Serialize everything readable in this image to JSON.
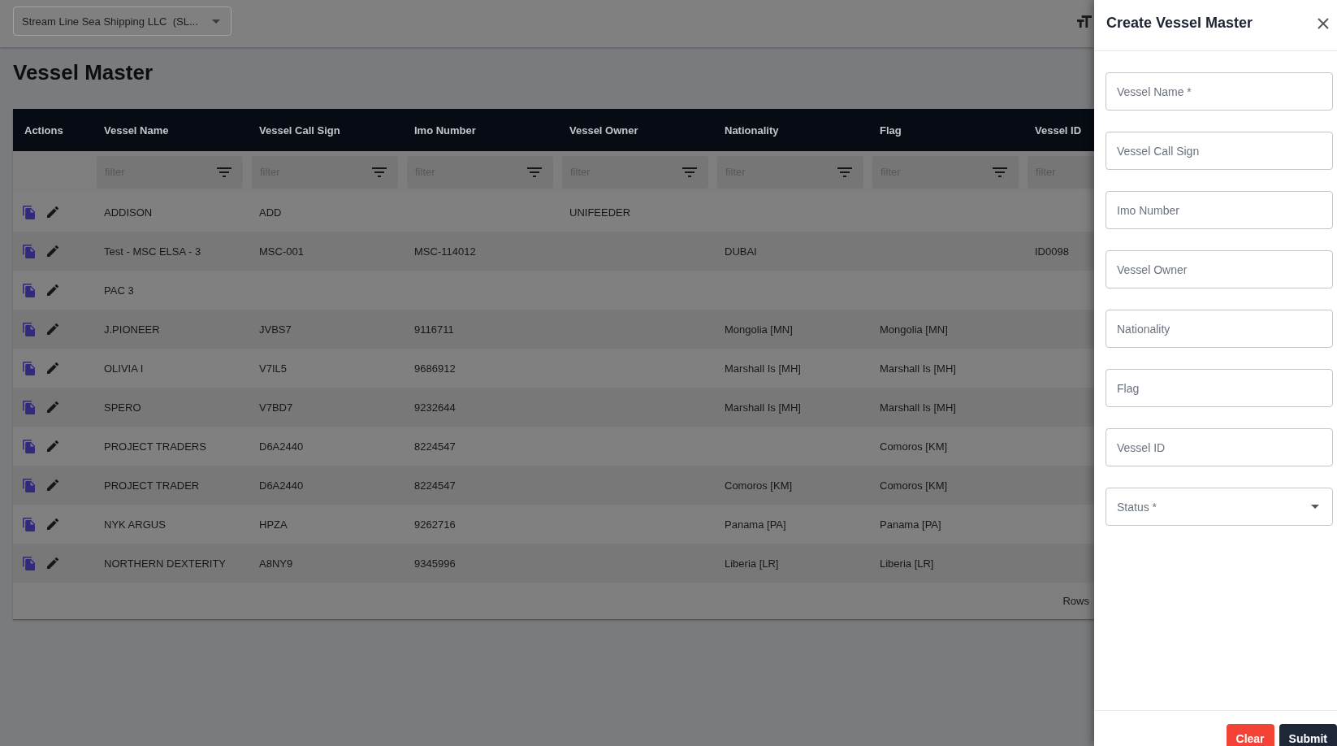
{
  "company_selector": {
    "value": "Stream Line Sea Shipping LLC  (SL..."
  },
  "page_title": "Vessel Master",
  "table": {
    "actions_header": "Actions",
    "columns": [
      {
        "label": "Vessel Name",
        "filter_placeholder": "filter"
      },
      {
        "label": "Vessel Call Sign",
        "filter_placeholder": "filter"
      },
      {
        "label": "Imo Number",
        "filter_placeholder": "filter"
      },
      {
        "label": "Vessel Owner",
        "filter_placeholder": "filter"
      },
      {
        "label": "Nationality",
        "filter_placeholder": "filter"
      },
      {
        "label": "Flag",
        "filter_placeholder": "filter"
      },
      {
        "label": "Vessel ID",
        "filter_placeholder": "filter"
      }
    ],
    "rows": [
      {
        "cells": [
          "ADDISON",
          "ADD",
          null,
          "UNIFEEDER",
          null,
          null,
          null
        ]
      },
      {
        "cells": [
          "Test - MSC ELSA - 3",
          "MSC-001",
          "MSC-114012",
          null,
          "DUBAI",
          null,
          "ID0098"
        ]
      },
      {
        "cells": [
          "PAC 3",
          null,
          null,
          null,
          null,
          null,
          null
        ]
      },
      {
        "cells": [
          "J.PIONEER",
          "JVBS7",
          "9116711",
          null,
          "Mongolia [MN]",
          "Mongolia [MN]",
          null
        ]
      },
      {
        "cells": [
          "OLIVIA I",
          "V7IL5",
          "9686912",
          null,
          "Marshall Is [MH]",
          "Marshall Is [MH]",
          null
        ]
      },
      {
        "cells": [
          "SPERO",
          "V7BD7",
          "9232644",
          null,
          "Marshall Is [MH]",
          "Marshall Is [MH]",
          null
        ]
      },
      {
        "cells": [
          "PROJECT TRADERS",
          "D6A2440",
          "8224547",
          null,
          null,
          "Comoros [KM]",
          null
        ]
      },
      {
        "cells": [
          "PROJECT TRADER",
          "D6A2440",
          "8224547",
          null,
          "Comoros [KM]",
          "Comoros [KM]",
          null
        ]
      },
      {
        "cells": [
          "NYK ARGUS",
          "HPZA",
          "9262716",
          null,
          "Panama [PA]",
          "Panama [PA]",
          null
        ]
      },
      {
        "cells": [
          "NORTHERN DEXTERITY",
          "A8NY9",
          "9345996",
          null,
          "Liberia [LR]",
          "Liberia [LR]",
          null
        ]
      }
    ],
    "footer": {
      "rows_per_page_label": "Rows"
    }
  },
  "create_panel": {
    "title": "Create Vessel Master",
    "fields": [
      {
        "kind": "text",
        "placeholder": "Vessel Name *"
      },
      {
        "kind": "text",
        "placeholder": "Vessel Call Sign"
      },
      {
        "kind": "text",
        "placeholder": "Imo Number"
      },
      {
        "kind": "text",
        "placeholder": "Vessel Owner"
      },
      {
        "kind": "text",
        "placeholder": "Nationality"
      },
      {
        "kind": "text",
        "placeholder": "Flag"
      },
      {
        "kind": "text",
        "placeholder": "Vessel ID"
      },
      {
        "kind": "select",
        "placeholder": "Status *"
      }
    ],
    "buttons": [
      {
        "kind": "danger",
        "label": "Clear"
      },
      {
        "kind": "primary",
        "label": "Submit"
      }
    ]
  }
}
